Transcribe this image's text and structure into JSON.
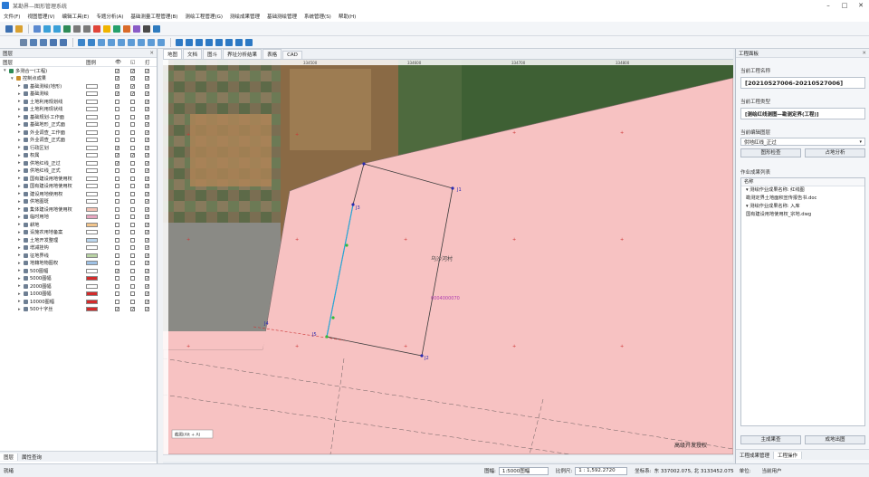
{
  "window": {
    "title": "某勘界—图形管理系统",
    "controls": [
      "–",
      "□",
      "✕"
    ]
  },
  "menu": [
    "文件(F)",
    "视图管理(V)",
    "编辑工具(E)",
    "专题分析(A)",
    "基础测量工程管理(B)",
    "测绘工程管理(G)",
    "测绘成果管理",
    "基础测绘管理",
    "系统管理(S)",
    "帮助(H)"
  ],
  "left_panel": {
    "title": "图层",
    "columns": {
      "layer": "图层",
      "legend": "图例",
      "visible": "👁",
      "select": "◱",
      "edit": "打"
    },
    "tree": [
      {
        "label": "多测合一(工程)",
        "indent": 0,
        "color": "",
        "vis": true,
        "sel": true,
        "edt": true
      },
      {
        "label": "控制点成果",
        "indent": 1,
        "color": "",
        "vis": true,
        "sel": true,
        "edt": true
      },
      {
        "label": "基础测绘(地形)",
        "indent": 2,
        "color": "#ffffff",
        "vis": true,
        "sel": true,
        "edt": true
      },
      {
        "label": "基础测绘",
        "indent": 2,
        "color": "#ffffff",
        "vis": true,
        "sel": true,
        "edt": true
      },
      {
        "label": "土地利用规划线",
        "indent": 2,
        "color": "#ffffff",
        "vis": false,
        "sel": false,
        "edt": true
      },
      {
        "label": "土地利用现状线",
        "indent": 2,
        "color": "#ffffff",
        "vis": false,
        "sel": false,
        "edt": true
      },
      {
        "label": "基础规划·工作面",
        "indent": 2,
        "color": "#ffffff",
        "vis": false,
        "sel": false,
        "edt": true
      },
      {
        "label": "基础地形_正式面",
        "indent": 2,
        "color": "#ffffff",
        "vis": false,
        "sel": false,
        "edt": true
      },
      {
        "label": "外业调查_工作面",
        "indent": 2,
        "color": "#ffffff",
        "vis": false,
        "sel": false,
        "edt": true
      },
      {
        "label": "外业调查_正式面",
        "indent": 2,
        "color": "#ffffff",
        "vis": false,
        "sel": false,
        "edt": true
      },
      {
        "label": "行政区划",
        "indent": 2,
        "color": "#ffffff",
        "vis": true,
        "sel": false,
        "edt": true
      },
      {
        "label": "权属",
        "indent": 2,
        "color": "#ffffff",
        "vis": true,
        "sel": true,
        "edt": true
      },
      {
        "label": "供地红线_正过",
        "indent": 2,
        "color": "#ffffff",
        "vis": true,
        "sel": false,
        "edt": true
      },
      {
        "label": "供地红线_正式",
        "indent": 2,
        "color": "#ffffff",
        "vis": false,
        "sel": false,
        "edt": true
      },
      {
        "label": "国有建设用地使用权",
        "indent": 2,
        "color": "#ffffff",
        "vis": false,
        "sel": false,
        "edt": true
      },
      {
        "label": "国有建设用地使用权",
        "indent": 2,
        "color": "#ffffff",
        "vis": false,
        "sel": false,
        "edt": true
      },
      {
        "label": "建设用地使用权",
        "indent": 2,
        "color": "#ffffff",
        "vis": false,
        "sel": false,
        "edt": true
      },
      {
        "label": "供地图斑",
        "indent": 2,
        "color": "#ffffff",
        "vis": false,
        "sel": false,
        "edt": true
      },
      {
        "label": "集体建设用地使用权",
        "indent": 2,
        "color": "#f5c4b6",
        "vis": false,
        "sel": false,
        "edt": true
      },
      {
        "label": "临时用地",
        "indent": 2,
        "color": "#e8a6c0",
        "vis": false,
        "sel": false,
        "edt": true
      },
      {
        "label": "耕地",
        "indent": 2,
        "color": "#f1c48b",
        "vis": false,
        "sel": false,
        "edt": true
      },
      {
        "label": "设施农用地备案",
        "indent": 2,
        "color": "#ffffff",
        "vis": false,
        "sel": false,
        "edt": true
      },
      {
        "label": "土地开发整理",
        "indent": 2,
        "color": "#bcd7ee",
        "vis": false,
        "sel": false,
        "edt": true
      },
      {
        "label": "增减挂钩",
        "indent": 2,
        "color": "#ffffff",
        "vis": false,
        "sel": false,
        "edt": true
      },
      {
        "label": "征地界线",
        "indent": 2,
        "color": "#b9d3a4",
        "vis": false,
        "sel": false,
        "edt": true
      },
      {
        "label": "地籍地物图权",
        "indent": 2,
        "color": "#9fc2e6",
        "vis": false,
        "sel": false,
        "edt": true
      },
      {
        "label": "500图幅",
        "indent": 2,
        "color": "#ffffff",
        "vis": true,
        "sel": false,
        "edt": true
      },
      {
        "label": "5000图幅",
        "indent": 2,
        "color": "#d42b2b",
        "vis": false,
        "sel": false,
        "edt": true
      },
      {
        "label": "2000图幅",
        "indent": 2,
        "color": "#ffffff",
        "vis": false,
        "sel": false,
        "edt": true
      },
      {
        "label": "1000图幅",
        "indent": 2,
        "color": "#d42b2b",
        "vis": false,
        "sel": false,
        "edt": true
      },
      {
        "label": "10000图幅",
        "indent": 2,
        "color": "#d42b2b",
        "vis": false,
        "sel": false,
        "edt": true
      },
      {
        "label": "500十字丝",
        "indent": 2,
        "color": "#d42b2b",
        "vis": true,
        "sel": true,
        "edt": true
      }
    ],
    "bottom_tabs": [
      "图层",
      "属性查询"
    ]
  },
  "map_tabs": [
    "地图",
    "文档",
    "图斗",
    "界址分析结果",
    "表格",
    "CAD"
  ],
  "map": {
    "parcel_label": "乌沙河村",
    "parcel_code": "0004000070",
    "vertex_labels": [
      "J1",
      "J2",
      "J3",
      "J4",
      "J5"
    ],
    "ruler_labels": [
      "334500",
      "334600",
      "334700",
      "334800",
      "334900"
    ],
    "tooltip": "截图(Alt + A)",
    "watermark": "高级开发授权"
  },
  "right_panel": {
    "title": "工程面板",
    "project_name_label": "当前工程名称",
    "project_name": "[20210527006-20210527006]",
    "project_type_label": "当前工程类型",
    "project_type": "[测绘红线测图—勘测定界(工程)]",
    "edit_layer_label": "当前编辑图层",
    "edit_layer": "供地红线_正过",
    "btn_query": "图形检查",
    "btn_analysis": "占地分析",
    "result_list_label": "作业成果列表",
    "result_header": "名称",
    "results": [
      "▾ 测绘作业成果名称: 红线图",
      "   勘测定界土地面积宣传报告书.doc",
      "▾ 测绘作业成果名称: 入库",
      "   国有建设用地使用权_宗地.dwg"
    ],
    "btn_main_report": "主成果查",
    "btn_export": "成地出图",
    "bottom_tabs": [
      "工程成果管理",
      "工程操作"
    ]
  },
  "status": {
    "left": "就绪",
    "layer_label": "图幅:",
    "layer_value": "1:5000图幅",
    "scale_label": "比例尺:",
    "scale_value": "1 : 1,592.2720",
    "coord_label": "坐标系:",
    "coord": "东 337002.075, 北 3133452.075",
    "unit_label": "单位:",
    "user": "当前用户"
  }
}
